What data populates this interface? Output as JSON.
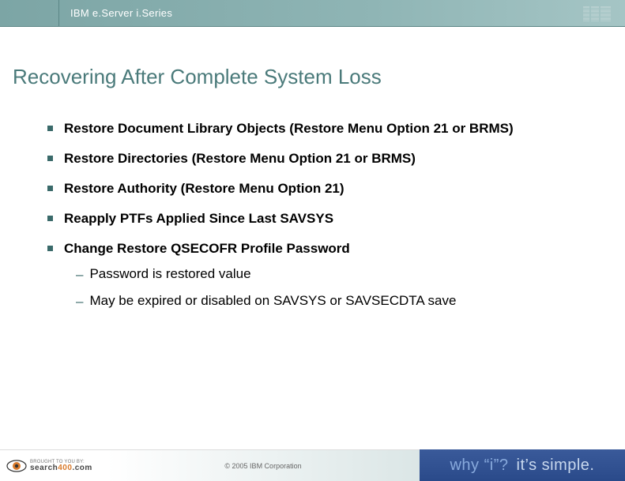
{
  "header": {
    "product_line": "IBM e.Server i.Series"
  },
  "title": "Recovering After Complete System Loss",
  "bullets": [
    {
      "text": "Restore Document Library Objects (Restore Menu Option 21 or BRMS)"
    },
    {
      "text": "Restore Directories (Restore Menu Option 21 or BRMS)"
    },
    {
      "text": "Restore Authority (Restore Menu Option 21)"
    },
    {
      "text": "Reapply PTFs Applied Since Last SAVSYS"
    },
    {
      "text": "Change Restore QSECOFR Profile Password",
      "subs": [
        "Password is restored value",
        "May be expired or disabled on SAVSYS or SAVSECDTA save"
      ]
    }
  ],
  "footer": {
    "brought_by_label": "BROUGHT TO YOU BY:",
    "search400_prefix": "search",
    "search400_suffix": "400",
    "search400_tld": ".com",
    "copyright": "© 2005 IBM Corporation",
    "why_i": "why “i”?",
    "simple": "it’s simple."
  }
}
